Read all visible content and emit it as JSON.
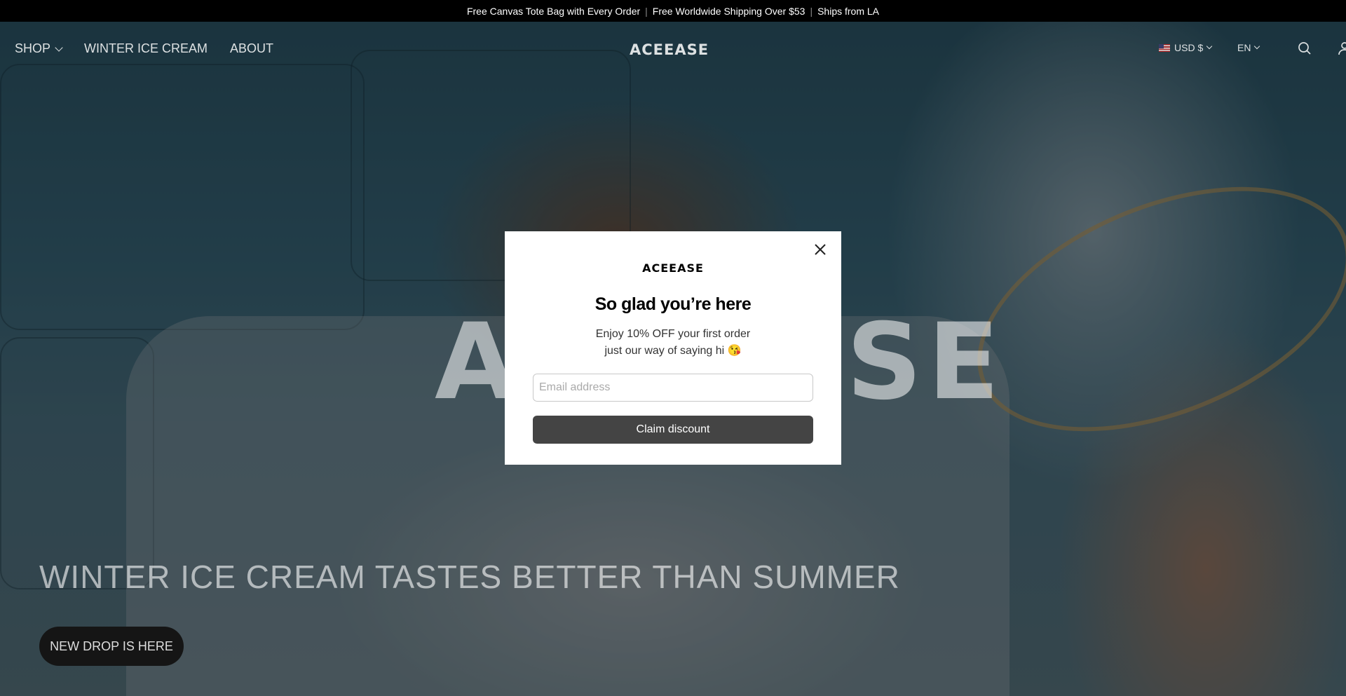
{
  "announcement": {
    "items": [
      "Free Canvas Tote Bag with Every Order",
      "Free Worldwide Shipping Over $53",
      "Ships from LA"
    ],
    "separator": "|"
  },
  "header": {
    "nav": [
      {
        "label": "SHOP",
        "has_dropdown": true
      },
      {
        "label": "WINTER ICE CREAM",
        "has_dropdown": false
      },
      {
        "label": "ABOUT",
        "has_dropdown": false
      }
    ],
    "logo": "ACEEASE",
    "currency": "USD $",
    "language": "EN",
    "icons": [
      "search-icon",
      "account-icon",
      "wishlist-icon",
      "cart-icon"
    ]
  },
  "hero": {
    "big_logo": "ACEEASE",
    "heading": "WINTER ICE CREAM TASTES BETTER THAN SUMMER",
    "cta_label": "NEW DROP IS HERE"
  },
  "modal": {
    "logo": "ACEEASE",
    "title": "So glad you’re here",
    "line1": "Enjoy 10% OFF your first order",
    "line2": "just our way of saying hi 😘",
    "email_placeholder": "Email address",
    "email_value": "",
    "button_label": "Claim discount"
  },
  "colors": {
    "announcement_bg": "#000000",
    "button_bg": "#444444",
    "cta_bg": "#151515"
  }
}
